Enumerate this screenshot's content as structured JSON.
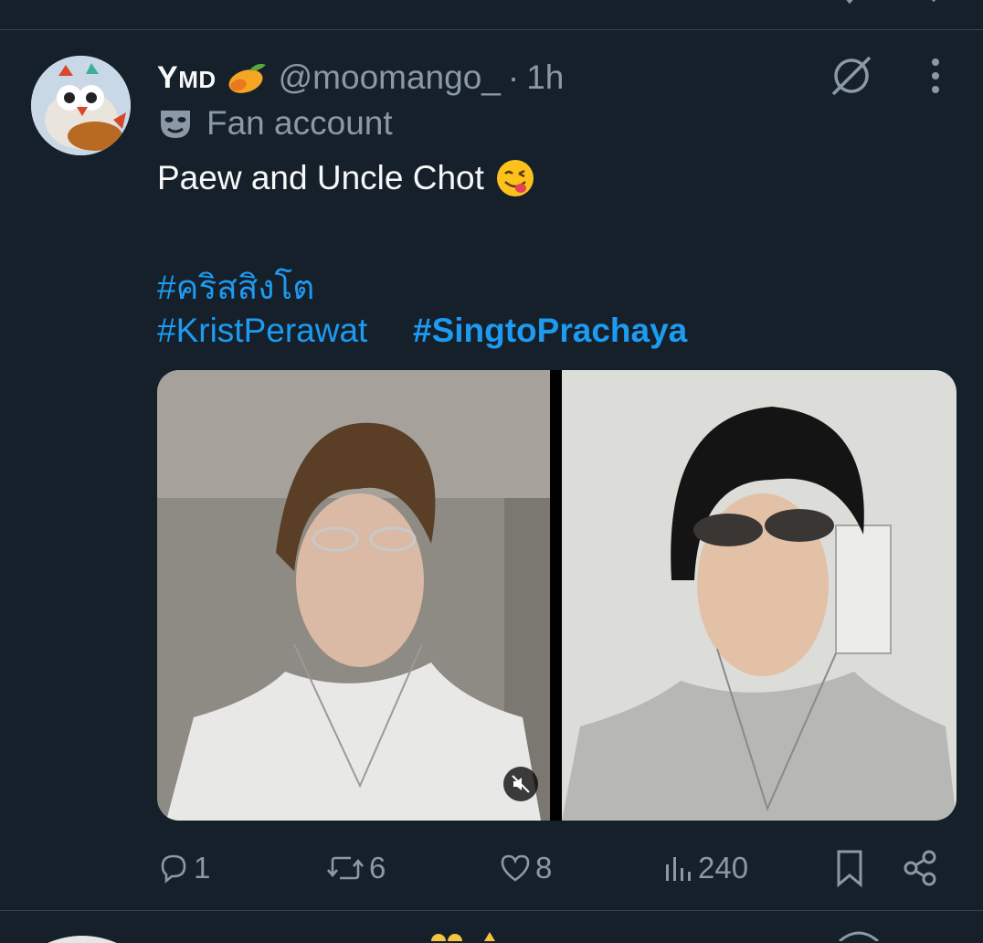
{
  "tweet": {
    "author": {
      "display_name_first": "Y",
      "display_name_rest": "MD",
      "name_emoji": "mango-emoji",
      "handle": "@moomango_",
      "separator": "·",
      "time": "1h"
    },
    "affiliation": {
      "icon": "mask-icon",
      "label": "Fan account"
    },
    "text": "Paew and Uncle Chot",
    "text_emoji": "face-savoring-food-emoji",
    "hashtags": [
      "#คริสสิงโต",
      "#KristPerawat",
      "#SingtoPrachaya"
    ],
    "media": [
      {
        "icon": "photo",
        "has_mute_button": true
      },
      {
        "icon": "photo",
        "has_mute_button": false
      }
    ],
    "actions": {
      "reply_count": "1",
      "retweet_count": "6",
      "like_count": "8",
      "views_count": "240"
    }
  },
  "colors": {
    "background": "#15202b",
    "divider": "#38444d",
    "text_primary": "#f7f9f9",
    "text_secondary": "#8b98a5",
    "link": "#1d9bf0"
  }
}
